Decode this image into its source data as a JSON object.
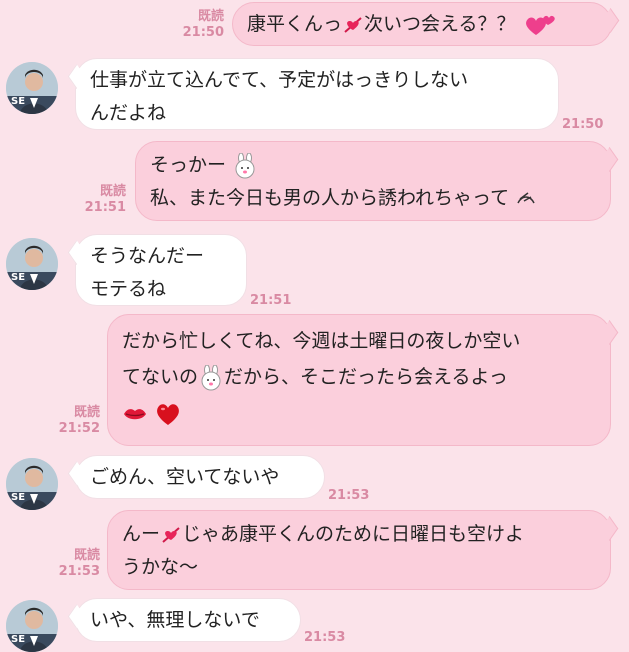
{
  "messages": [
    {
      "side": "me",
      "lines": [
        "康平くんっ",
        "次いつ会える？？"
      ],
      "read": "既読",
      "time": "21:50"
    },
    {
      "side": "them",
      "lines": [
        "仕事が立て込んでて、予定がはっきりしない",
        "んだよね"
      ],
      "time": "21:50"
    },
    {
      "side": "me",
      "lines": [
        "そっかー",
        "私、また今日も男の人から誘われちゃって"
      ],
      "read": "既読",
      "time": "21:51"
    },
    {
      "side": "them",
      "lines": [
        "そうなんだー",
        "モテるね"
      ],
      "time": "21:51"
    },
    {
      "side": "me",
      "lines": [
        "だから忙しくてね、今週は土曜日の夜しか空い",
        "てないの",
        "だから、そこだったら会えるよっ"
      ],
      "read": "既読",
      "time": "21:52"
    },
    {
      "side": "them",
      "lines": [
        "ごめん、空いてないや"
      ],
      "time": "21:53"
    },
    {
      "side": "me",
      "lines": [
        "んー",
        "じゃあ康平くんのために日曜日も空けよ",
        "うかな〜"
      ],
      "read": "既読",
      "time": "21:53"
    },
    {
      "side": "them",
      "lines": [
        "いや、無理しないで"
      ],
      "time": "21:53"
    }
  ],
  "avatar_text": "SE",
  "icons": {
    "heart_arrow": "heart-arrow-icon",
    "pink_hearts": "pink-hearts-icon",
    "bunny": "bunny-face-icon",
    "tears": "crying-doodle-icon",
    "kiss": "lips-icon",
    "red_heart": "red-heart-icon"
  },
  "colors": {
    "background": "#fbe3ea",
    "my_bubble": "#fbcfdc",
    "their_bubble": "#ffffff",
    "meta_text": "#d98aa3"
  }
}
